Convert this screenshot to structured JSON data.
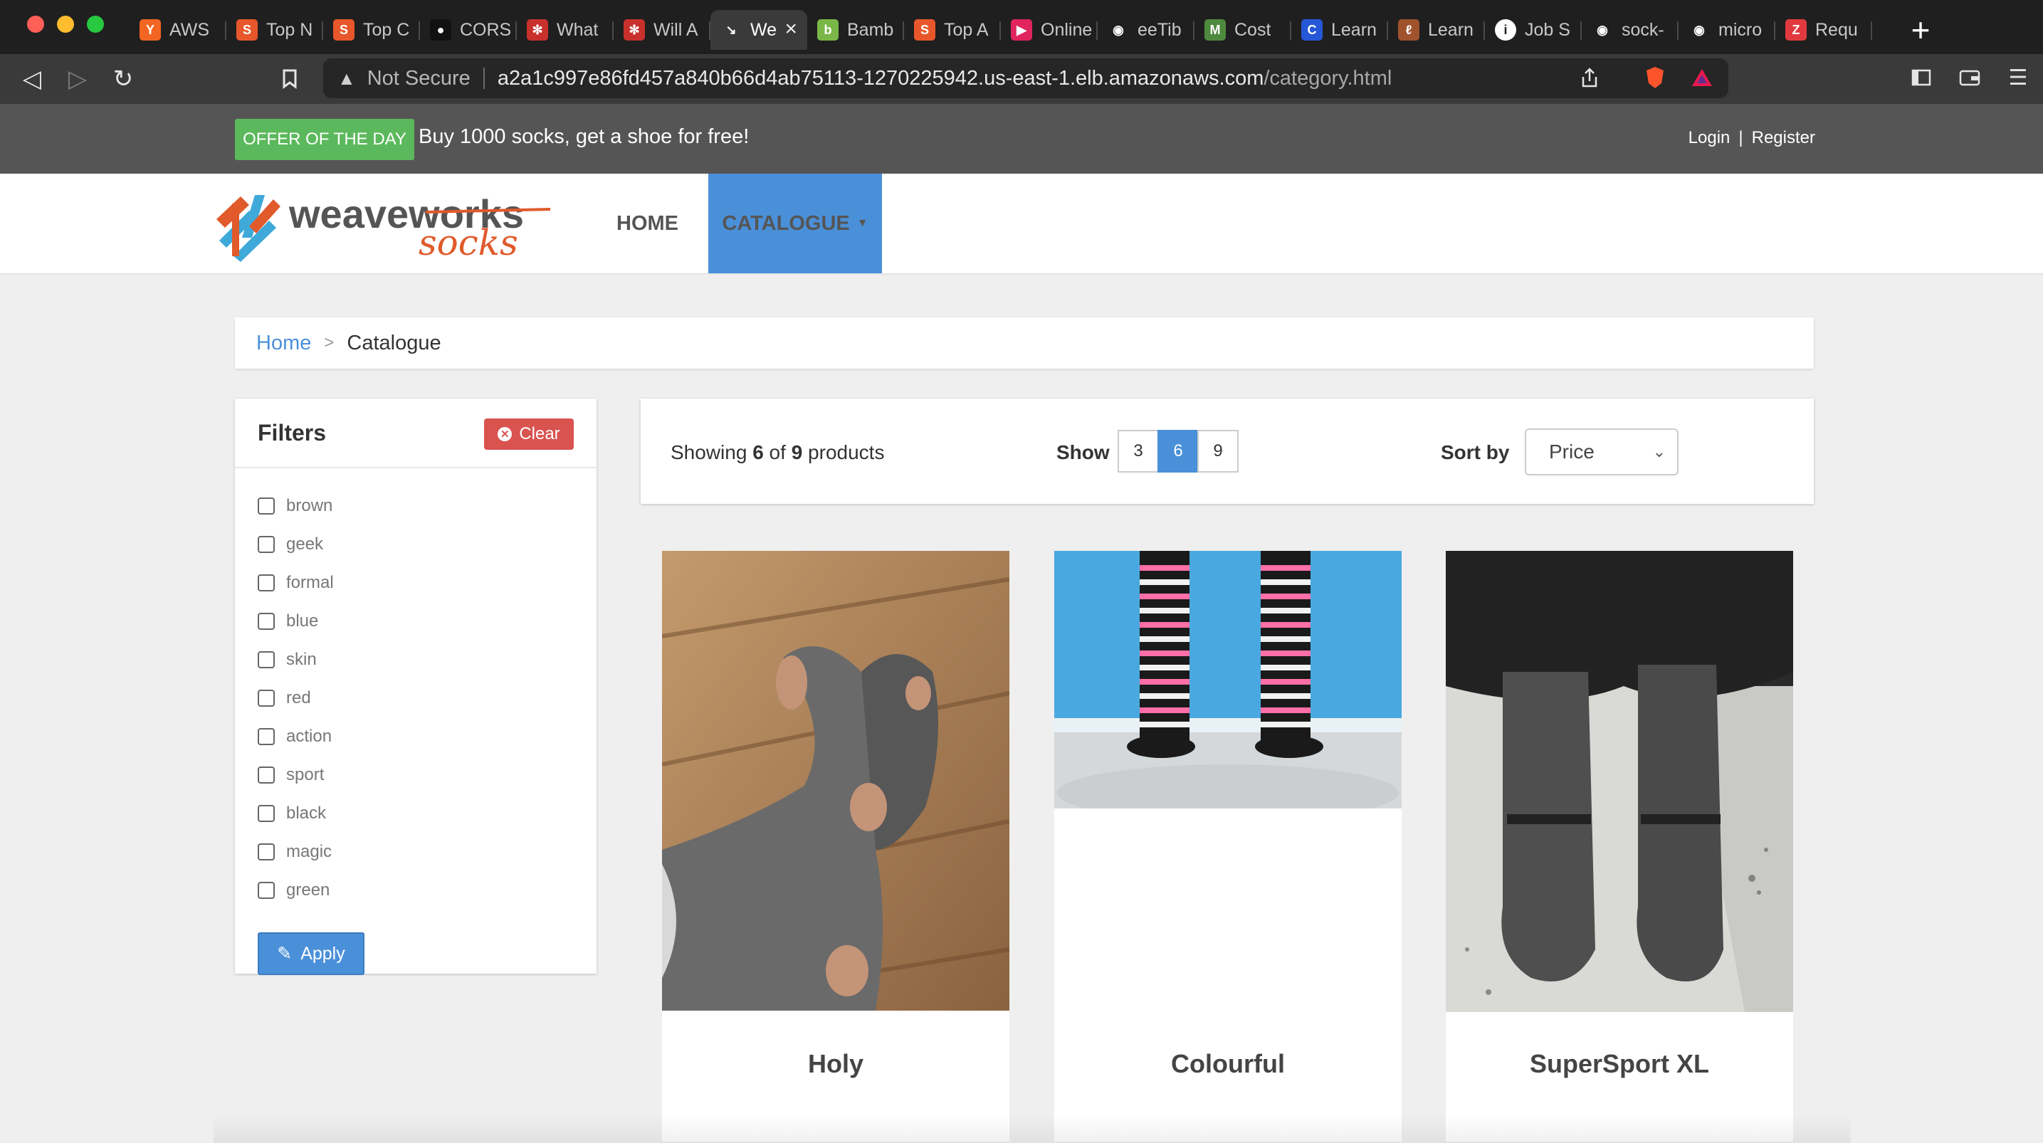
{
  "browser": {
    "tabs": [
      {
        "label": "AWS",
        "icon": "y-icon",
        "color": "#f26522",
        "glyph": "Y"
      },
      {
        "label": "Top N",
        "icon": "s-icon",
        "color": "#e8572b",
        "glyph": "S"
      },
      {
        "label": "Top C",
        "icon": "s-icon",
        "color": "#e8572b",
        "glyph": "S"
      },
      {
        "label": "CORS",
        "icon": "dark-icon",
        "color": "#111111",
        "glyph": "●"
      },
      {
        "label": "What",
        "icon": "gear-icon",
        "color": "#c8302c",
        "glyph": "✻"
      },
      {
        "label": "Will A",
        "icon": "gear-icon",
        "color": "#c8302c",
        "glyph": "✻"
      },
      {
        "label": "We",
        "icon": "weave-icon",
        "color": "#3a3a3a",
        "glyph": "↘",
        "active": true
      },
      {
        "label": "Bamb",
        "icon": "bamboo-icon",
        "color": "#7ab648",
        "glyph": "b"
      },
      {
        "label": "Top A",
        "icon": "s-icon",
        "color": "#e8572b",
        "glyph": "S"
      },
      {
        "label": "Online",
        "icon": "play-icon",
        "color": "#e0245e",
        "glyph": "▶"
      },
      {
        "label": "eeTib",
        "icon": "github-icon",
        "color": "#1f1f1f",
        "glyph": "◉"
      },
      {
        "label": "Cost",
        "icon": "chart-icon",
        "color": "#4e8a3e",
        "glyph": "M"
      },
      {
        "label": "Learn",
        "icon": "c-icon",
        "color": "#2557d6",
        "glyph": "C"
      },
      {
        "label": "Learn",
        "icon": "pen-icon",
        "color": "#a0522d",
        "glyph": "ℓ"
      },
      {
        "label": "Job S",
        "icon": "info-icon",
        "color": "#ffffff",
        "glyph": "i"
      },
      {
        "label": "sock-",
        "icon": "github-icon",
        "color": "#1f1f1f",
        "glyph": "◉"
      },
      {
        "label": "micro",
        "icon": "github-icon",
        "color": "#1f1f1f",
        "glyph": "◉"
      },
      {
        "label": "Requ",
        "icon": "z-icon",
        "color": "#e03a3e",
        "glyph": "Z"
      }
    ],
    "not_secure": "Not Secure",
    "url_host": "a2a1c997e86fd457a840b66d4ab75113-1270225942.us-east-1.elb.amazonaws.com",
    "url_path": "/category.html"
  },
  "offer": {
    "badge": "OFFER OF THE DAY",
    "text": "Buy 1000 socks, get a shoe for free!"
  },
  "account": {
    "login": "Login",
    "separator": "|",
    "register": "Register"
  },
  "nav": {
    "home": "HOME",
    "catalogue": "CATALOGUE"
  },
  "logo": {
    "word1": "weaveworks",
    "word2": "socks"
  },
  "breadcrumb": {
    "home": "Home",
    "separator": ">",
    "current": "Catalogue"
  },
  "filters": {
    "title": "Filters",
    "clear": "Clear",
    "apply": "Apply",
    "tags": [
      "brown",
      "geek",
      "formal",
      "blue",
      "skin",
      "red",
      "action",
      "sport",
      "black",
      "magic",
      "green"
    ]
  },
  "listing": {
    "showing_prefix": "Showing ",
    "showing_count": "6",
    "showing_of": " of ",
    "showing_total": "9",
    "showing_suffix": " products",
    "show_label": "Show",
    "page_sizes": [
      "3",
      "6",
      "9"
    ],
    "selected_page_size": "6",
    "sort_label": "Sort by",
    "sort_value": "Price"
  },
  "products": [
    {
      "name": "Holy"
    },
    {
      "name": "Colourful"
    },
    {
      "name": "SuperSport XL"
    }
  ],
  "colors": {
    "accent_blue": "#4a90d9",
    "offer_green": "#5cb85c",
    "clear_red": "#d9534f",
    "logo_orange": "#e05a2b"
  }
}
